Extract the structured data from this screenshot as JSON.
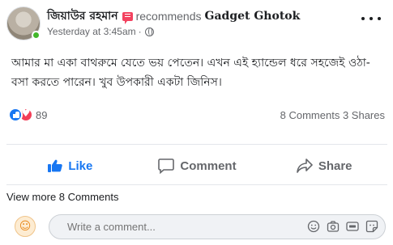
{
  "post": {
    "author": "জিয়াউর রহমান",
    "recommends_text": "recommends",
    "page_name": "Gadget Ghotok",
    "time": "Yesterday at 3:45am",
    "separator": "·",
    "text": "আমার মা একা বাথরুমে যেতে ভয় পেতেন। এখন এই হ্যান্ডেল ধরে সহজেই ওঠা-বসা করতে পারেন। খুব উপকারী একটা জিনিস।"
  },
  "stats": {
    "reaction_count": "89",
    "comments": "8 Comments",
    "shares": "3 Shares"
  },
  "actions": {
    "like": "Like",
    "comment": "Comment",
    "share": "Share"
  },
  "comments": {
    "view_more": "View more 8 Comments",
    "placeholder": "Write a comment..."
  },
  "icons": {
    "more": "more-icon",
    "globe": "globe-icon",
    "recommend": "recommend-icon",
    "like_reaction": "like-reaction-icon",
    "love_reaction": "love-reaction-icon",
    "like": "thumbs-up-icon",
    "comment": "comment-icon",
    "share": "share-icon",
    "emoji": "emoji-icon",
    "camera": "camera-icon",
    "gif": "gif-icon",
    "sticker": "sticker-icon"
  },
  "colors": {
    "accent": "#1877f2",
    "love": "#f33e58",
    "online": "#42b72a",
    "muted_text": "#65676b"
  }
}
